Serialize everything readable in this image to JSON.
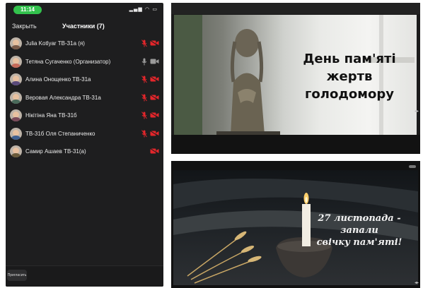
{
  "phone": {
    "status_time": "11:14",
    "close_label": "Закрыть",
    "title": "Участники (7)",
    "invite_label": "Пригласить",
    "participants": [
      {
        "name": "Julia Kotlyar ТВ-31а (я)",
        "mic": "muted",
        "video": "off"
      },
      {
        "name": "Тетяна Сугаченко (Организатор)",
        "mic": "on",
        "video": "on"
      },
      {
        "name": "Алина Онощенко ТВ-31а",
        "mic": "muted",
        "video": "off"
      },
      {
        "name": "Веровая Александра ТВ-31а",
        "mic": "muted",
        "video": "off"
      },
      {
        "name": "Нікітіна Яна ТВ-31б",
        "mic": "muted",
        "video": "off"
      },
      {
        "name": "ТВ-31б Оля Степаниченко",
        "mic": "muted",
        "video": "off"
      },
      {
        "name": "Самир Ашаев ТВ-31(а)",
        "mic": "none",
        "video": "off"
      }
    ]
  },
  "slides": {
    "slide1": {
      "title_line1": "День пам'яті",
      "title_line2": "жертв",
      "title_line3": "голодомору"
    },
    "slide2": {
      "title_line1": "27 листопада -",
      "title_line2": "запали",
      "title_line3": "свічку пам'яті!"
    }
  },
  "colors": {
    "accent_green": "#33c24d",
    "muted_red": "#e3262b",
    "phone_bg": "#1e1e1f"
  }
}
